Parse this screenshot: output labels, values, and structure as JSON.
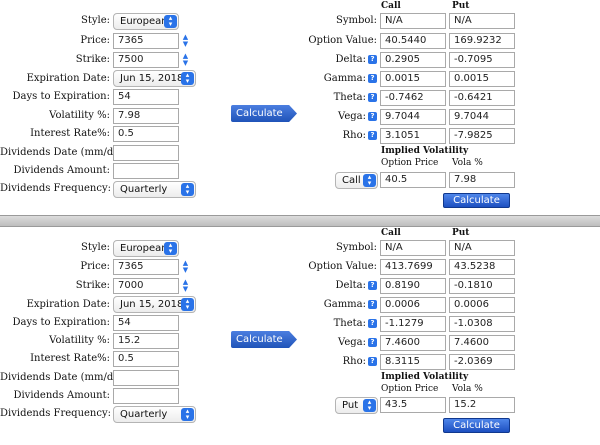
{
  "labels": {
    "style": "Style:",
    "price": "Price:",
    "strike": "Strike:",
    "expiration": "Expiration Date:",
    "days": "Days to Expiration:",
    "volatility": "Volatility %:",
    "interest": "Interest Rate%:",
    "div_date": "Dividends Date (mm/dd/yy):",
    "div_amount": "Dividends Amount:",
    "div_freq": "Dividends Frequency:",
    "calculate": "Calculate",
    "col_call": "Call",
    "col_put": "Put",
    "symbol": "Symbol:",
    "option_value": "Option Value:",
    "delta": "Delta:",
    "gamma": "Gamma:",
    "theta": "Theta:",
    "vega": "Vega:",
    "rho": "Rho:",
    "implied_vol": "Implied Volatility",
    "option_price": "Option Price",
    "vola_pct": "Vola %",
    "help_glyph": "?"
  },
  "panels": [
    {
      "style": "European",
      "price": "7365",
      "strike": "7500",
      "expiration": "Jun 15, 2018",
      "days": "54",
      "volatility": "7.98",
      "interest": "0.5",
      "div_date": "",
      "div_amount": "",
      "div_freq": "Quarterly",
      "symbol_call": "N/A",
      "symbol_put": "N/A",
      "value_call": "40.5440",
      "value_put": "169.9232",
      "delta_call": "0.2905",
      "delta_put": "-0.7095",
      "gamma_call": "0.0015",
      "gamma_put": "0.0015",
      "theta_call": "-0.7462",
      "theta_put": "-0.6421",
      "vega_call": "9.7044",
      "vega_put": "9.7044",
      "rho_call": "3.1051",
      "rho_put": "-7.9825",
      "iv_type": "Call",
      "iv_price": "40.5",
      "iv_vola": "7.98"
    },
    {
      "style": "European",
      "price": "7365",
      "strike": "7000",
      "expiration": "Jun 15, 2018",
      "days": "54",
      "volatility": "15.2",
      "interest": "0.5",
      "div_date": "",
      "div_amount": "",
      "div_freq": "Quarterly",
      "symbol_call": "N/A",
      "symbol_put": "N/A",
      "value_call": "413.7699",
      "value_put": "43.5238",
      "delta_call": "0.8190",
      "delta_put": "-0.1810",
      "gamma_call": "0.0006",
      "gamma_put": "0.0006",
      "theta_call": "-1.1279",
      "theta_put": "-1.0308",
      "vega_call": "7.4600",
      "vega_put": "7.4600",
      "rho_call": "8.3115",
      "rho_put": "-2.0369",
      "iv_type": "Put",
      "iv_price": "43.5",
      "iv_vola": "15.2"
    }
  ]
}
